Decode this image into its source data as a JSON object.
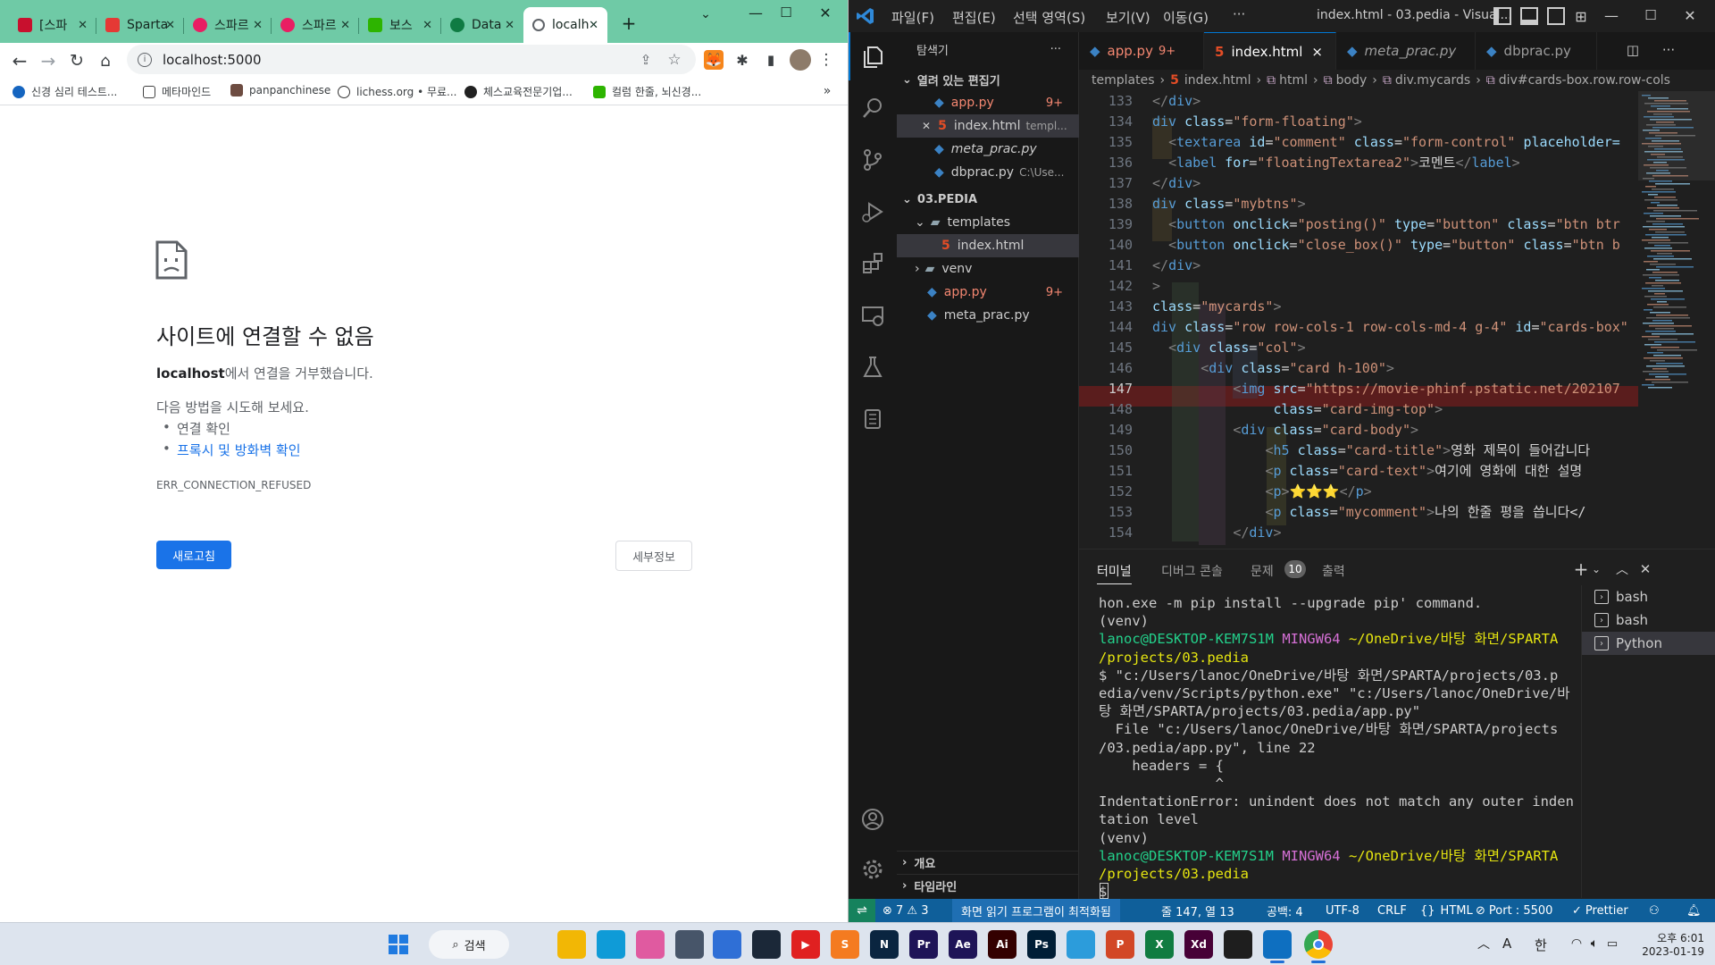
{
  "browser": {
    "tabs": [
      {
        "title": "[스파",
        "color": "#c8102e"
      },
      {
        "title": "Sparta",
        "color": "#e53935"
      },
      {
        "title": "스파르",
        "color": "#e91e63"
      },
      {
        "title": "스파르",
        "color": "#e91e63"
      },
      {
        "title": "보스",
        "color": "#2db400"
      },
      {
        "title": "Data",
        "color": "#0f7b43"
      },
      {
        "title": "localh",
        "color": "#5f6368"
      }
    ],
    "new_tab": "+",
    "url": "localhost:5000",
    "bookmarks": [
      {
        "label": "신경 심리 테스트...",
        "color": "#1565c0"
      },
      {
        "label": "메타마인드",
        "color": "#424242"
      },
      {
        "label": "panpanchinese",
        "color": "#6d4c41"
      },
      {
        "label": "lichess.org • 무료...",
        "color": "#333333"
      },
      {
        "label": "체스교육전문기업...",
        "color": "#212121"
      },
      {
        "label": "컬럼 한줄, 뇌신경...",
        "color": "#2db400"
      }
    ],
    "error": {
      "title": "사이트에 연결할 수 없음",
      "host": "localhost",
      "refused_suffix": "에서 연결을 거부했습니다.",
      "try_label": "다음 방법을 시도해 보세요.",
      "suggestions": [
        "연결 확인",
        "프록시 및 방화벽 확인"
      ],
      "code": "ERR_CONNECTION_REFUSED",
      "reload_label": "새로고침",
      "details_label": "세부정보"
    }
  },
  "vscode": {
    "menu": [
      "파일(F)",
      "편집(E)",
      "선택 영역(S)",
      "보기(V)",
      "이동(G)",
      "···"
    ],
    "window_title": "index.html - 03.pedia - Visual...",
    "explorer": {
      "header": "탐색기",
      "open_editors_label": "열려 있는 편집기",
      "open_editors": [
        {
          "name": "app.py",
          "badge": "9+",
          "detail": ""
        },
        {
          "name": "index.html",
          "badge": "",
          "detail": "templ..."
        },
        {
          "name": "meta_prac.py",
          "badge": "",
          "detail": ""
        },
        {
          "name": "dbprac.py",
          "badge": "",
          "detail": "C:\\Use..."
        }
      ],
      "project_label": "03.PEDIA",
      "tree": [
        {
          "name": "templates"
        },
        {
          "name": "index.html"
        },
        {
          "name": "venv"
        },
        {
          "name": "app.py",
          "badge": "9+"
        },
        {
          "name": "meta_prac.py"
        }
      ],
      "outline_label": "개요",
      "timeline_label": "타임라인"
    },
    "editor_tabs": [
      {
        "name": "app.py",
        "badge": "9+"
      },
      {
        "name": "index.html",
        "close": "×"
      },
      {
        "name": "meta_prac.py"
      },
      {
        "name": "dbprac.py"
      }
    ],
    "breadcrumb": [
      "templates",
      "index.html",
      "html",
      "body",
      "div.mycards",
      "div#cards-box.row.row-cols"
    ],
    "code_lines": [
      {
        "n": "133",
        "parts": [
          [
            "p",
            "</"
          ],
          [
            "t",
            "div"
          ],
          [
            "p",
            ">"
          ]
        ]
      },
      {
        "n": "134",
        "parts": [
          [
            "t",
            "div"
          ],
          [
            "w",
            " "
          ],
          [
            "a",
            "class"
          ],
          [
            "w",
            "="
          ],
          [
            "s",
            "\"form-floating\""
          ],
          [
            "p",
            ">"
          ]
        ]
      },
      {
        "n": "135",
        "parts": [
          [
            "w",
            "  "
          ],
          [
            "p",
            "<"
          ],
          [
            "t",
            "textarea"
          ],
          [
            "w",
            " "
          ],
          [
            "a",
            "id"
          ],
          [
            "w",
            "="
          ],
          [
            "s",
            "\"comment\""
          ],
          [
            "w",
            " "
          ],
          [
            "a",
            "class"
          ],
          [
            "w",
            "="
          ],
          [
            "s",
            "\"form-control\""
          ],
          [
            "w",
            " "
          ],
          [
            "a",
            "placeholder="
          ]
        ]
      },
      {
        "n": "136",
        "parts": [
          [
            "w",
            "  "
          ],
          [
            "p",
            "<"
          ],
          [
            "t",
            "label"
          ],
          [
            "w",
            " "
          ],
          [
            "a",
            "for"
          ],
          [
            "w",
            "="
          ],
          [
            "s",
            "\"floatingTextarea2\""
          ],
          [
            "p",
            ">"
          ],
          [
            "w",
            "코멘트"
          ],
          [
            "p",
            "</"
          ],
          [
            "t",
            "label"
          ],
          [
            "p",
            ">"
          ]
        ]
      },
      {
        "n": "137",
        "parts": [
          [
            "p",
            "</"
          ],
          [
            "t",
            "div"
          ],
          [
            "p",
            ">"
          ]
        ]
      },
      {
        "n": "138",
        "parts": [
          [
            "t",
            "div"
          ],
          [
            "w",
            " "
          ],
          [
            "a",
            "class"
          ],
          [
            "w",
            "="
          ],
          [
            "s",
            "\"mybtns\""
          ],
          [
            "p",
            ">"
          ]
        ]
      },
      {
        "n": "139",
        "parts": [
          [
            "w",
            "  "
          ],
          [
            "p",
            "<"
          ],
          [
            "t",
            "button"
          ],
          [
            "w",
            " "
          ],
          [
            "a",
            "onclick"
          ],
          [
            "w",
            "="
          ],
          [
            "s",
            "\"posting()\""
          ],
          [
            "w",
            " "
          ],
          [
            "a",
            "type"
          ],
          [
            "w",
            "="
          ],
          [
            "s",
            "\"button\""
          ],
          [
            "w",
            " "
          ],
          [
            "a",
            "class"
          ],
          [
            "w",
            "="
          ],
          [
            "s",
            "\"btn btr"
          ]
        ]
      },
      {
        "n": "140",
        "parts": [
          [
            "w",
            "  "
          ],
          [
            "p",
            "<"
          ],
          [
            "t",
            "button"
          ],
          [
            "w",
            " "
          ],
          [
            "a",
            "onclick"
          ],
          [
            "w",
            "="
          ],
          [
            "s",
            "\"close_box()\""
          ],
          [
            "w",
            " "
          ],
          [
            "a",
            "type"
          ],
          [
            "w",
            "="
          ],
          [
            "s",
            "\"button\""
          ],
          [
            "w",
            " "
          ],
          [
            "a",
            "class"
          ],
          [
            "w",
            "="
          ],
          [
            "s",
            "\"btn b"
          ]
        ]
      },
      {
        "n": "141",
        "parts": [
          [
            "p",
            "</"
          ],
          [
            "t",
            "div"
          ],
          [
            "p",
            ">"
          ]
        ]
      },
      {
        "n": "142",
        "parts": [
          [
            "p",
            ">"
          ]
        ]
      },
      {
        "n": "143",
        "parts": [
          [
            "a",
            "class"
          ],
          [
            "w",
            "="
          ],
          [
            "s",
            "\"mycards\""
          ],
          [
            "p",
            ">"
          ]
        ]
      },
      {
        "n": "144",
        "parts": [
          [
            "t",
            "div"
          ],
          [
            "w",
            " "
          ],
          [
            "a",
            "class"
          ],
          [
            "w",
            "="
          ],
          [
            "s",
            "\"row row-cols-1 row-cols-md-4 g-4\""
          ],
          [
            "w",
            " "
          ],
          [
            "a",
            "id"
          ],
          [
            "w",
            "="
          ],
          [
            "s",
            "\"cards-box\""
          ]
        ]
      },
      {
        "n": "145",
        "parts": [
          [
            "w",
            "  "
          ],
          [
            "p",
            "<"
          ],
          [
            "t",
            "div"
          ],
          [
            "w",
            " "
          ],
          [
            "a",
            "class"
          ],
          [
            "w",
            "="
          ],
          [
            "s",
            "\"col\""
          ],
          [
            "p",
            ">"
          ]
        ]
      },
      {
        "n": "146",
        "parts": [
          [
            "w",
            "      "
          ],
          [
            "p",
            "<"
          ],
          [
            "t",
            "div"
          ],
          [
            "w",
            " "
          ],
          [
            "a",
            "class"
          ],
          [
            "w",
            "="
          ],
          [
            "s",
            "\"card h-100\""
          ],
          [
            "p",
            ">"
          ]
        ]
      },
      {
        "n": "147",
        "parts": [
          [
            "w",
            "          "
          ],
          [
            "p",
            "<"
          ],
          [
            "t",
            "img"
          ],
          [
            "w",
            " "
          ],
          [
            "a",
            "src"
          ],
          [
            "w",
            "="
          ],
          [
            "s",
            "\"https://movie-phinf.pstatic.net/202107"
          ]
        ]
      },
      {
        "n": "148",
        "parts": [
          [
            "w",
            "               "
          ],
          [
            "a",
            "class"
          ],
          [
            "w",
            "="
          ],
          [
            "s",
            "\"card-img-top\""
          ],
          [
            "p",
            ">"
          ]
        ]
      },
      {
        "n": "149",
        "parts": [
          [
            "w",
            "          "
          ],
          [
            "p",
            "<"
          ],
          [
            "t",
            "div"
          ],
          [
            "w",
            " "
          ],
          [
            "a",
            "class"
          ],
          [
            "w",
            "="
          ],
          [
            "s",
            "\"card-body\""
          ],
          [
            "p",
            ">"
          ]
        ]
      },
      {
        "n": "150",
        "parts": [
          [
            "w",
            "              "
          ],
          [
            "p",
            "<"
          ],
          [
            "t",
            "h5"
          ],
          [
            "w",
            " "
          ],
          [
            "a",
            "class"
          ],
          [
            "w",
            "="
          ],
          [
            "s",
            "\"card-title\""
          ],
          [
            "p",
            ">"
          ],
          [
            "w",
            "영화 제목이 들어갑니다"
          ]
        ]
      },
      {
        "n": "151",
        "parts": [
          [
            "w",
            "              "
          ],
          [
            "p",
            "<"
          ],
          [
            "t",
            "p"
          ],
          [
            "w",
            " "
          ],
          [
            "a",
            "class"
          ],
          [
            "w",
            "="
          ],
          [
            "s",
            "\"card-text\""
          ],
          [
            "p",
            ">"
          ],
          [
            "w",
            "여기에 영화에 대한 설명"
          ]
        ]
      },
      {
        "n": "152",
        "parts": [
          [
            "w",
            "              "
          ],
          [
            "p",
            "<"
          ],
          [
            "t",
            "p"
          ],
          [
            "p",
            ">"
          ],
          [
            "y",
            "⭐⭐⭐"
          ],
          [
            "p",
            "</"
          ],
          [
            "t",
            "p"
          ],
          [
            "p",
            ">"
          ]
        ]
      },
      {
        "n": "153",
        "parts": [
          [
            "w",
            "              "
          ],
          [
            "p",
            "<"
          ],
          [
            "t",
            "p"
          ],
          [
            "w",
            " "
          ],
          [
            "a",
            "class"
          ],
          [
            "w",
            "="
          ],
          [
            "s",
            "\"mycomment\""
          ],
          [
            "p",
            ">"
          ],
          [
            "w",
            "나의 한줄 평을 씁니다</"
          ]
        ]
      },
      {
        "n": "154",
        "parts": [
          [
            "w",
            "          "
          ],
          [
            "p",
            "</"
          ],
          [
            "t",
            "div"
          ],
          [
            "p",
            ">"
          ]
        ]
      }
    ],
    "panel": {
      "tabs": [
        "터미널",
        "디버그 콘솔",
        "문제",
        "출력"
      ],
      "problems_count": "10",
      "terminal_lines": [
        [
          [
            "w",
            "hon.exe -m pip install --upgrade pip' command."
          ]
        ],
        [
          [
            "w",
            "(venv)"
          ]
        ],
        [
          [
            "g",
            "lanoc@DESKTOP-KEM7S1M "
          ],
          [
            "m",
            "MINGW64 "
          ],
          [
            "y",
            "~/OneDrive/바탕 화면/SPARTA"
          ]
        ],
        [
          [
            "y",
            "/projects/03.pedia"
          ]
        ],
        [
          [
            "w",
            "$ \"c:/Users/lanoc/OneDrive/바탕 화면/SPARTA/projects/03.p"
          ]
        ],
        [
          [
            "w",
            "edia/venv/Scripts/python.exe\" \"c:/Users/lanoc/OneDrive/바"
          ]
        ],
        [
          [
            "w",
            "탕 화면/SPARTA/projects/03.pedia/app.py\""
          ]
        ],
        [
          [
            "w",
            "  File \"c:/Users/lanoc/OneDrive/바탕 화면/SPARTA/projects"
          ]
        ],
        [
          [
            "w",
            "/03.pedia/app.py\", line 22"
          ]
        ],
        [
          [
            "w",
            "    headers = {"
          ]
        ],
        [
          [
            "w",
            "              ^"
          ]
        ],
        [
          [
            "w",
            "IndentationError: unindent does not match any outer inden"
          ]
        ],
        [
          [
            "w",
            "tation level"
          ]
        ],
        [
          [
            "w",
            "(venv)"
          ]
        ],
        [
          [
            "g",
            "lanoc@DESKTOP-KEM7S1M "
          ],
          [
            "m",
            "MINGW64 "
          ],
          [
            "y",
            "~/OneDrive/바탕 화면/SPARTA"
          ]
        ],
        [
          [
            "y",
            "/projects/03.pedia"
          ]
        ],
        [
          [
            "w",
            "$ "
          ]
        ]
      ],
      "terminals": [
        "bash",
        "bash",
        "Python"
      ]
    },
    "status": {
      "problems": "⊗ 7 ⚠ 3",
      "screen_reader": "화면 읽기 프로그램이 최적화됨",
      "position": "줄 147, 열 13",
      "spaces": "공백: 4",
      "encoding": "UTF-8",
      "eol": "CRLF",
      "language": "HTML",
      "port": "Port : 5500",
      "prettier": "Prettier"
    }
  },
  "taskbar": {
    "search_label": "검색",
    "ime": "한",
    "lang": "A",
    "time": "오후 6:01",
    "date": "2023-01-19",
    "apps": [
      {
        "icon": "windows-start-icon",
        "label": "",
        "color": "#1f7ae0"
      },
      {
        "icon": "task-view-icon",
        "label": "",
        "color": "#4b5563"
      },
      {
        "icon": "file-explorer-icon",
        "label": "",
        "color": "#f2b705"
      },
      {
        "icon": "edge-icon",
        "label": "",
        "color": "#0f9bd7"
      },
      {
        "icon": "paint-icon",
        "label": "",
        "color": "#e05aa0"
      },
      {
        "icon": "calculator-icon",
        "label": "",
        "color": "#475569"
      },
      {
        "icon": "notepad-icon",
        "label": "",
        "color": "#2f6fd6"
      },
      {
        "icon": "steam-icon",
        "label": "",
        "color": "#1b2838"
      },
      {
        "icon": "youtube-icon",
        "label": "▶",
        "color": "#e02020"
      },
      {
        "icon": "sublime-icon",
        "label": "S",
        "color": "#f47b20"
      },
      {
        "icon": "n-app-icon",
        "label": "N",
        "color": "#0a2540"
      },
      {
        "icon": "premiere-icon",
        "label": "Pr",
        "color": "#1e1457"
      },
      {
        "icon": "after-effects-icon",
        "label": "Ae",
        "color": "#1e1457"
      },
      {
        "icon": "illustrator-icon",
        "label": "Ai",
        "color": "#330000"
      },
      {
        "icon": "photoshop-icon",
        "label": "Ps",
        "color": "#001e36"
      },
      {
        "icon": "store-icon",
        "label": "",
        "color": "#2c9cdb"
      },
      {
        "icon": "powerpoint-icon",
        "label": "P",
        "color": "#d24726"
      },
      {
        "icon": "excel-icon",
        "label": "X",
        "color": "#107c41"
      },
      {
        "icon": "xd-icon",
        "label": "Xd",
        "color": "#470137"
      },
      {
        "icon": "figma-icon",
        "label": "",
        "color": "#1e1e1e"
      },
      {
        "icon": "vscode-icon",
        "label": "",
        "color": "#0e6fc0"
      },
      {
        "icon": "chrome-icon",
        "label": "",
        "color": "#e8eaed"
      }
    ]
  }
}
